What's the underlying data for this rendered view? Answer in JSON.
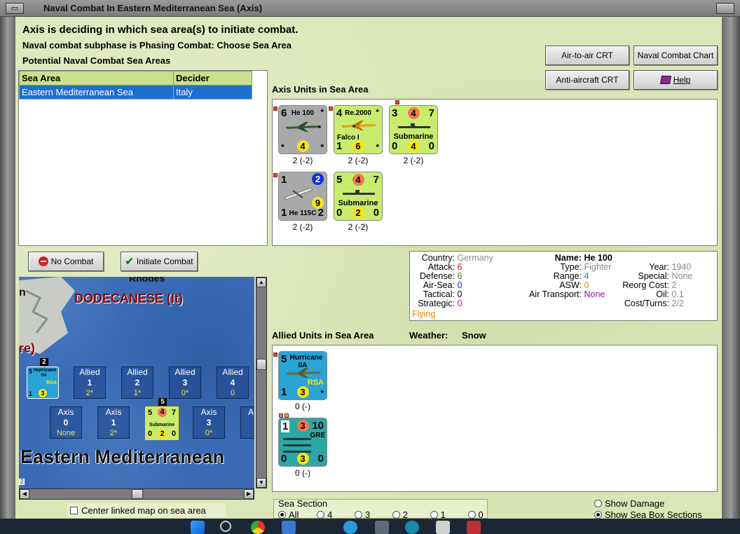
{
  "window": {
    "title": "Naval Combat In Eastern Mediterranean Sea (Axis)",
    "menu_glyph": "▭"
  },
  "header": {
    "line1": "Axis is deciding in which sea area(s) to initiate combat.",
    "line2": "Naval combat subphase is Phasing Combat: Choose Sea Area",
    "line3": "Potential Naval Combat Sea Areas"
  },
  "buttons": {
    "air_to_air_crt": "Air-to-air CRT",
    "naval_combat_chart": "Naval Combat Chart",
    "anti_aircraft_crt": "Anti-aircraft CRT",
    "help": "Help",
    "no_combat": "No Combat",
    "initiate_combat": "Initiate Combat"
  },
  "sea_table": {
    "headers": [
      "Sea Area",
      "Decider"
    ],
    "rows": [
      {
        "sea_area": "Eastern Mediterranean Sea",
        "decider": "Italy"
      }
    ]
  },
  "axis_units": {
    "label": "Axis Units in Sea Area",
    "units": [
      {
        "tl": "6",
        "tr": "*",
        "name": "He 100",
        "bl": "*",
        "bm": "4",
        "br": "*",
        "caption": "2 (-2)"
      },
      {
        "tl": "4",
        "tr": "*",
        "name": "Re.2000",
        "sub": "Falco I",
        "bl": "1",
        "bm": "6",
        "br": "*",
        "caption": "2 (-2)"
      },
      {
        "tl": "3",
        "tm": "4",
        "tr": "7",
        "name": "Submarine",
        "bl": "0",
        "bm": "4",
        "br": "0",
        "caption": "2 (-2)"
      },
      {
        "tl": "1",
        "tr": "2",
        "mr": "9",
        "bl": "1",
        "name": "He 115C",
        "br": "2",
        "caption": "2 (-2)"
      },
      {
        "tl": "5",
        "tm": "4",
        "tr": "7",
        "name": "Submarine",
        "bl": "0",
        "bm": "2",
        "br": "0",
        "caption": "2 (-2)"
      }
    ]
  },
  "info": {
    "country_label": "Country:",
    "country": "Germany",
    "attack_label": "Attack:",
    "attack": "6",
    "defense_label": "Defense:",
    "defense": "6",
    "airsea_label": "Air-Sea:",
    "airsea": "0",
    "tactical_label": "Tactical:",
    "tactical": "0",
    "strategic_label": "Strategic:",
    "strategic": "0",
    "flying": "Flying",
    "name_label": "Name:",
    "name": "He 100",
    "type_label": "Type:",
    "type": "Fighter",
    "range_label": "Range:",
    "range": "4",
    "asw_label": "ASW:",
    "asw": "0",
    "air_transport_label": "Air Transport:",
    "air_transport": "None",
    "year_label": "Year:",
    "year": "1940",
    "special_label": "Special:",
    "special": "None",
    "reorg_label": "Reorg Cost:",
    "reorg": "2",
    "oil_label": "Oil:",
    "oil": "0.1",
    "cost_label": "Cost/Turns:",
    "cost": "2/2"
  },
  "allied_units": {
    "label": "Allied Units in Sea Area",
    "weather_label": "Weather:",
    "weather": "Snow",
    "units": [
      {
        "tl": "5",
        "name": "Hurricane",
        "sub": "IIA",
        "tag": "RSA",
        "bl": "1",
        "bm": "3",
        "br": "*",
        "caption": "0 (-)"
      },
      {
        "tl": "1",
        "tm": "3",
        "tr": "10",
        "tag": "GRE",
        "bl": "0",
        "bm": "3",
        "br": "0",
        "caption": "0 (-)"
      }
    ]
  },
  "map": {
    "labels": {
      "rhodes": "Rhodes",
      "dodecanese": "DODECANESE (It)",
      "partial": "re)",
      "partial_n": "n",
      "sea_name": "Eastern Mediterranean"
    },
    "allied_boxes": [
      {
        "title": "Allied",
        "num": "1",
        "sub": "2*"
      },
      {
        "title": "Allied",
        "num": "2",
        "sub": "1*"
      },
      {
        "title": "Allied",
        "num": "3",
        "sub": "0*"
      },
      {
        "title": "Allied",
        "num": "4",
        "sub": "0"
      }
    ],
    "axis_boxes": [
      {
        "title": "Axis",
        "num": "0",
        "sub": "None"
      },
      {
        "title": "Axis",
        "num": "1",
        "sub": "2*"
      },
      {
        "title": "Axis",
        "num": "3",
        "sub": "0*"
      },
      {
        "title": "A",
        "num": "",
        "sub": ""
      }
    ],
    "stack_allied": "2",
    "stack_axis": "5",
    "stack_corner": "2",
    "mini_hurricane": {
      "tl": "5",
      "name": "Hurricane",
      "sub": "IIA",
      "tag": "RSA",
      "bl": "1",
      "bm": "3"
    },
    "mini_sub": {
      "tl": "5",
      "tm": "4",
      "tr": "7",
      "name": "Submarine",
      "bl": "0",
      "bm": "2",
      "br": "0"
    }
  },
  "center_linked": "Center linked map on sea area",
  "sea_section": {
    "label": "Sea Section",
    "options": [
      "All",
      "4",
      "3",
      "2",
      "1",
      "0"
    ],
    "selected": "All"
  },
  "show_damage": "Show Damage",
  "show_sea_box": "Show Sea Box Sections",
  "colors": {
    "accent": "#1e6fd0",
    "panel_bg": "#dbe6b8",
    "header_green": "#c9e08f"
  }
}
